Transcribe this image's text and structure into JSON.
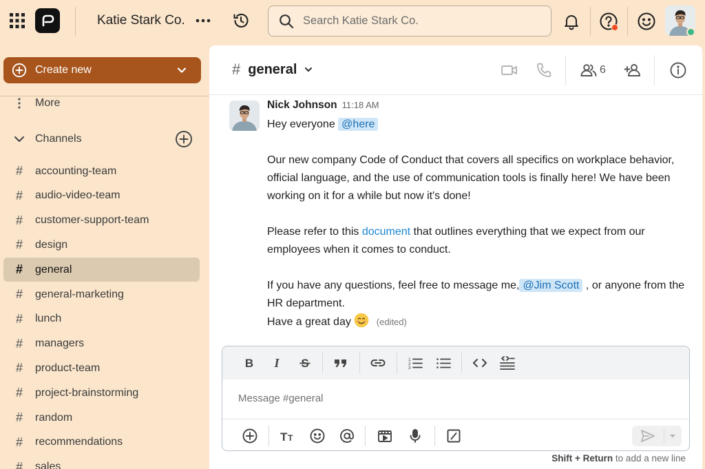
{
  "topbar": {
    "team_name": "Katie Stark Co.",
    "search_placeholder": "Search Katie Stark Co.",
    "colors": {
      "notification_dot": "#f04b24",
      "online": "#3db887"
    }
  },
  "sidebar": {
    "create_new_label": "Create new",
    "more_label": "More",
    "channels_header": "Channels",
    "channels": [
      {
        "label": "accounting-team"
      },
      {
        "label": "audio-video-team"
      },
      {
        "label": "customer-support-team"
      },
      {
        "label": "design"
      },
      {
        "label": "general",
        "active": true
      },
      {
        "label": "general-marketing"
      },
      {
        "label": "lunch"
      },
      {
        "label": "managers"
      },
      {
        "label": "product-team"
      },
      {
        "label": "project-brainstorming"
      },
      {
        "label": "random"
      },
      {
        "label": "recommendations"
      },
      {
        "label": "sales"
      }
    ],
    "colors": {
      "create_button": "#a8551d",
      "active_item": "#dbcab0"
    }
  },
  "channel": {
    "name": "general",
    "member_count": "6"
  },
  "message": {
    "author": "Nick Johnson",
    "time": "11:18 AM",
    "line1_text": "Hey everyone",
    "mention_here": "@here",
    "para1": "Our new company Code of Conduct that covers all specifics on workplace behavior, official language, and the use of communication tools is finally here! We have been working on it for a while but now it's done!",
    "para2_before": "Please refer to this",
    "para2_link": "document",
    "para2_after": "that outlines everything that we expect from our employees when it comes to conduct.",
    "para3_before": "If you have any questions, feel free to message me,",
    "mention_user": "@Jim Scott",
    "para3_after": ", or anyone from the HR department.",
    "closing": "Have a great day",
    "edited_label": "(edited)"
  },
  "composer": {
    "placeholder": "Message #general",
    "hint_keys": "Shift + Return",
    "hint_text": "to add a new line",
    "format_tools": [
      "bold-icon",
      "italic-icon",
      "strikethrough-icon",
      "quote-icon",
      "link-icon",
      "numbered-list-icon",
      "bulleted-list-icon",
      "code-icon",
      "code-block-icon"
    ],
    "action_tools": [
      "attach-plus-icon",
      "text-format-icon",
      "emoji-icon",
      "mention-icon",
      "gif-icon",
      "microphone-icon",
      "slash-command-icon",
      "send-icon"
    ]
  }
}
